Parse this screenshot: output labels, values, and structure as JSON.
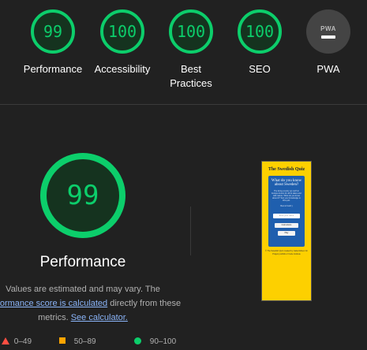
{
  "categories": [
    {
      "score": "99",
      "label": "Performance"
    },
    {
      "score": "100",
      "label": "Accessibility"
    },
    {
      "score": "100",
      "label": "Best Practices"
    },
    {
      "score": "100",
      "label": "SEO"
    },
    {
      "label": "PWA",
      "badge_text": "PWA"
    }
  ],
  "performance": {
    "score": "99",
    "label": "Performance",
    "desc_prefix": "Values are estimated and may vary. The",
    "score_link": "performance score is calculated",
    "desc_middle": "directly from these metrics.",
    "calc_link": "See calculator."
  },
  "legend": [
    {
      "range": "0–49",
      "color": "#ff4e42"
    },
    {
      "range": "50–89",
      "color": "#ffa400"
    },
    {
      "range": "90–100",
      "color": "#0cce6b"
    }
  ],
  "thumbnail": {
    "title": "The Swedish Quiz",
    "heading": "What do you know about Sweden?",
    "intro": "The living country up north in Europe known for all its lakes and wild nature. What do you know about it? Test your knowledge in this quiz.",
    "best_text": "Best of luck!:)",
    "input_placeholder": "Enter your name",
    "instructions_label": "Instructions",
    "play_label": "Play",
    "footer": "© The Swedish Quiz created by Isabel Ebsen for Project portfolio 2 Code Institute"
  },
  "colors": {
    "pass": "#0cce6b",
    "average": "#ffa400",
    "fail": "#ff4e42",
    "link": "#8ab4f8"
  }
}
